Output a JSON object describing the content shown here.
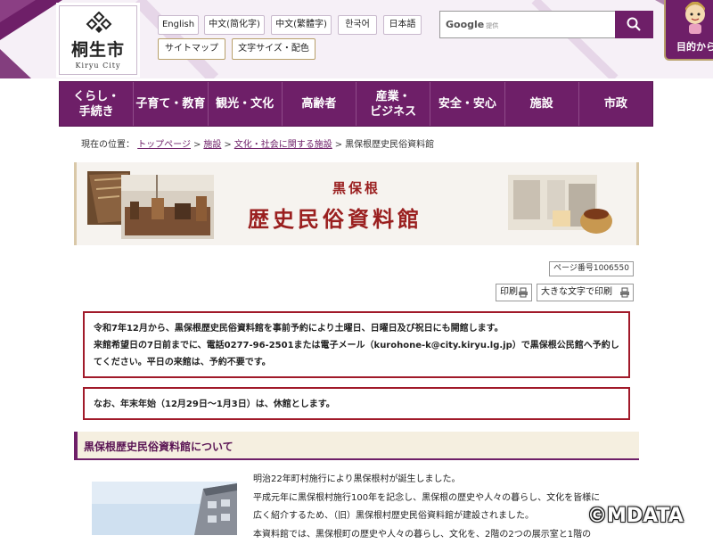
{
  "header": {
    "logo": {
      "name": "桐生市",
      "sub": "Kiryu City"
    },
    "languages": [
      "English",
      "中文(简化字)",
      "中文(繁體字)",
      "한국어",
      "日本語"
    ],
    "utility": {
      "sitemap": "サイトマップ",
      "font_color": "文字サイズ・配色"
    },
    "search": {
      "brand": "Google",
      "brand_sub": "提供",
      "placeholder": ""
    },
    "mokuteki": "目的から"
  },
  "gnav": [
    "くらし・\n手続き",
    "子育て・教育",
    "観光・文化",
    "高齢者",
    "産業・\nビジネス",
    "安全・安心",
    "施設",
    "市政"
  ],
  "breadcrumb": {
    "prefix": "現在の位置：",
    "links": [
      "トップページ",
      "施設",
      "文化・社会に関する施設"
    ],
    "current": "黒保根歴史民俗資料館"
  },
  "banner": {
    "small": "黒保根",
    "big": "歴史民俗資料館"
  },
  "page_number": "ページ番号1006550",
  "print": {
    "print": "印刷",
    "large_print": "大きな文字で印刷"
  },
  "notices": {
    "first": {
      "line1": "令和7年12月から、黒保根歴史民俗資料館を事前予約により土曜日、日曜日及び祝日にも開館します。",
      "line2": "来館希望日の7日前までに、電話0277-96-2501または電子メール（kurohone-k@city.kiryu.lg.jp）で黒保根公民館へ予約し",
      "line3": "てください。平日の来館は、予約不要です。"
    },
    "second": "なお、年末年始（12月29日～1月3日）は、休館とします。"
  },
  "section": {
    "title": "黒保根歴史民俗資料館について",
    "lines": [
      "明治22年町村施行により黒保根村が誕生しました。",
      "平成元年に黒保根村施行100年を記念し、黒保根の歴史や人々の暮らし、文化を皆様に",
      "広く紹介するため、（旧）黒保根村歴史民俗資料館が建設されました。",
      "本資料館では、黒保根町の歴史や人々の暮らし、文化を、2階の2つの展示室と1階の"
    ]
  },
  "watermark": "©MDATA"
}
